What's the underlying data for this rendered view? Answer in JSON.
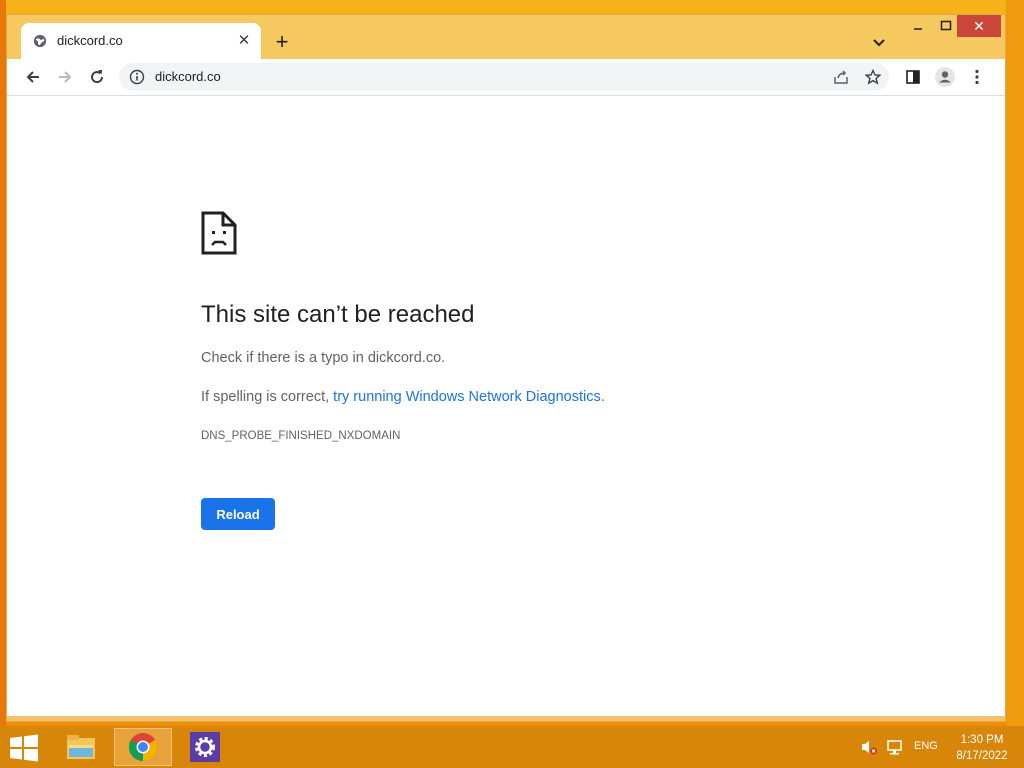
{
  "browser": {
    "tab": {
      "title": "dickcord.co"
    },
    "address_bar": {
      "url": "dickcord.co"
    }
  },
  "error_page": {
    "title": "This site can’t be reached",
    "line1": "Check if there is a typo in dickcord.co.",
    "line2_prefix": "If spelling is correct, ",
    "line2_link": "try running Windows Network Diagnostics",
    "line2_suffix": ".",
    "error_code": "DNS_PROBE_FINISHED_NXDOMAIN",
    "reload_label": "Reload"
  },
  "taskbar": {
    "language": "ENG",
    "time": "1:30 PM",
    "date": "8/17/2022"
  },
  "colors": {
    "accent": "#1a73e8",
    "desktop": "#f5a30e",
    "titlebar": "#f5c860"
  }
}
